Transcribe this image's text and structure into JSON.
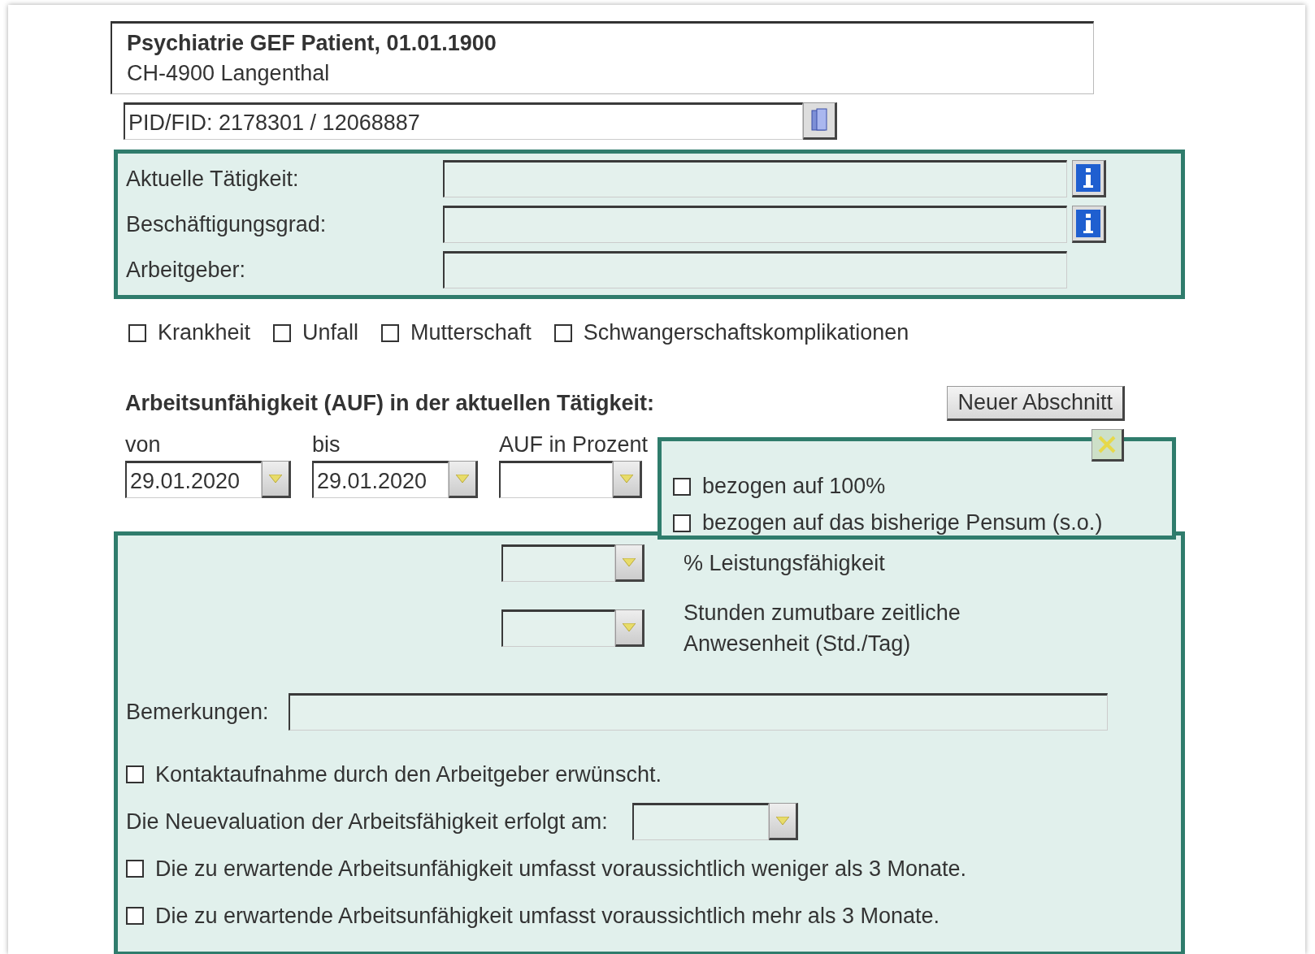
{
  "patient": {
    "name": "Psychiatrie GEF Patient, 01.01.1900",
    "address": "CH-4900 Langenthal"
  },
  "id_field": {
    "value": "PID/FID: 2178301 / 12068887"
  },
  "employment": [
    {
      "label": "Aktuelle Tätigkeit:",
      "info": true
    },
    {
      "label": "Beschäftigungsgrad:",
      "info": true
    },
    {
      "label": "Arbeitgeber:",
      "info": false
    }
  ],
  "reasons": [
    {
      "label": "Krankheit",
      "checked": false
    },
    {
      "label": "Unfall",
      "checked": false
    },
    {
      "label": "Mutterschaft",
      "checked": false
    },
    {
      "label": "Schwangerschaftskomplikationen",
      "checked": false
    }
  ],
  "section_title": "Arbeitsunfähigkeit (AUF) in der aktuellen Tätigkeit:",
  "new_section_button": "Neuer Abschnitt",
  "period": [
    {
      "label": "von",
      "value": "29.01.2020"
    },
    {
      "label": "bis",
      "value": "29.01.2020"
    },
    {
      "label": "AUF in Prozent"
    }
  ],
  "basis_options": [
    {
      "label": "bezogen auf 100%",
      "checked": false
    },
    {
      "label": "bezogen auf das bisherige Pensum (s.o.)",
      "checked": false
    }
  ],
  "capacity": [
    {
      "label": "% Leistungsfähigkeit"
    },
    {
      "label": "Stunden zumutbare zeitliche Anwesenheit (Std./Tag)"
    }
  ],
  "remarks_label": "Bemerkungen:",
  "options": [
    {
      "kind": "checkbox",
      "label": "Kontaktaufnahme durch den Arbeitgeber erwünscht.",
      "checked": false
    },
    {
      "kind": "date",
      "label": "Die Neuevaluation der Arbeitsfähigkeit erfolgt am:"
    },
    {
      "kind": "checkbox",
      "label": "Die zu erwartende Arbeitsunfähigkeit umfasst voraussichtlich weniger als 3 Monate.",
      "checked": false
    },
    {
      "kind": "checkbox",
      "label": "Die zu erwartende Arbeitsunfähigkeit umfasst voraussichtlich mehr als 3 Monate.",
      "checked": false
    }
  ]
}
